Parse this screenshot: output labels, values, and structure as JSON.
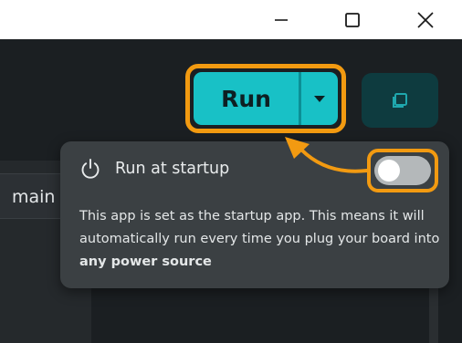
{
  "window_controls": {
    "minimize_icon": "minimize-icon",
    "maximize_icon": "maximize-icon",
    "close_icon": "close-icon"
  },
  "toolbar": {
    "run_label": "Run",
    "dropdown_icon": "chevron-down-icon",
    "stop_icon": "stop-square-icon"
  },
  "editor": {
    "tab_label": "main"
  },
  "startup_popover": {
    "icon": "power-icon",
    "title": "Run at startup",
    "body_text": "This app is set as the startup app. This means it will automatically run every time you plug your board into ",
    "body_emphasis": "any power source",
    "toggle_state": "off"
  },
  "colors": {
    "highlight_orange": "#f29a11",
    "run_button_teal": "#18c1c6",
    "popover_bg": "#3b4043",
    "app_bg": "#1b1f22"
  }
}
